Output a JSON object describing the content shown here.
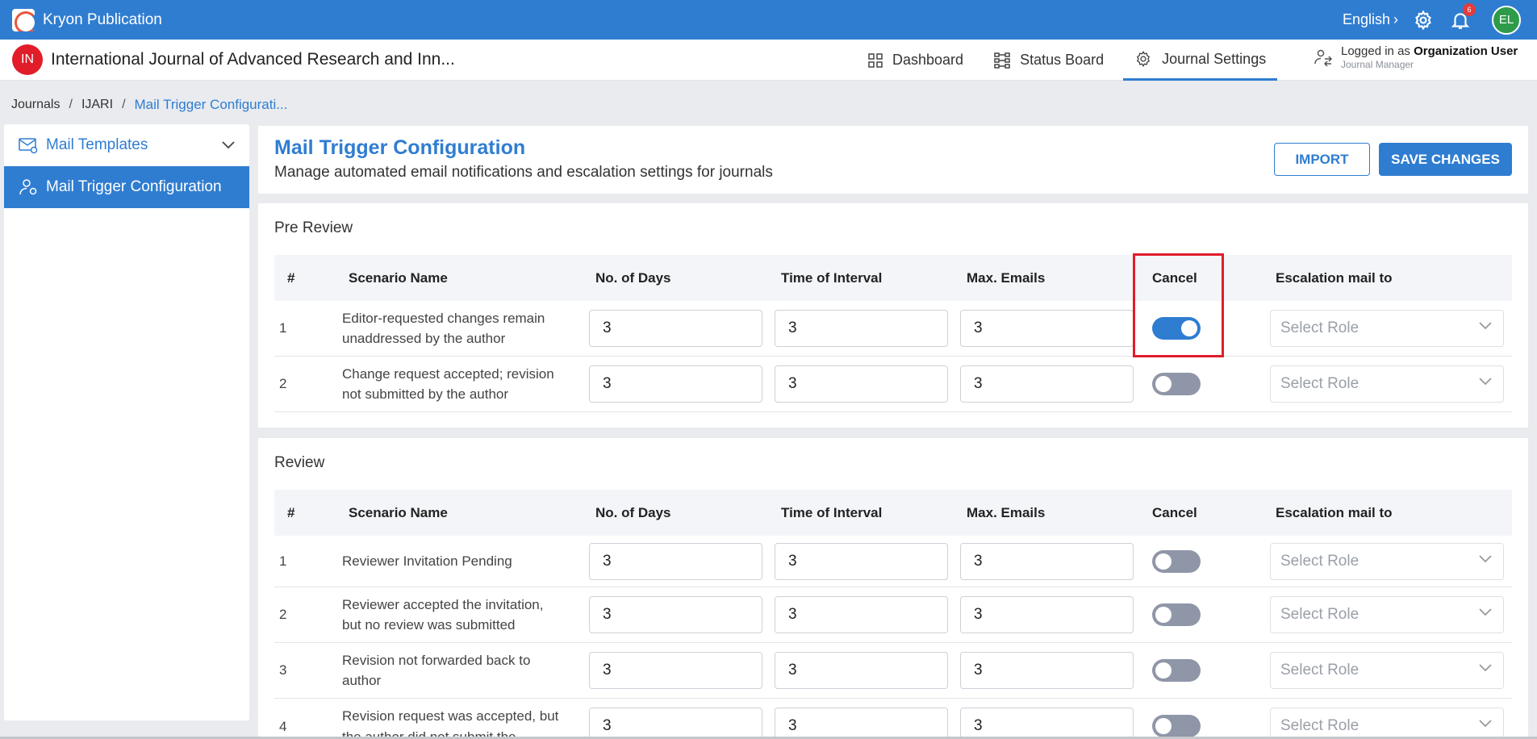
{
  "app": {
    "title": "Kryon Publication",
    "language": "English",
    "notification_count": "6",
    "avatar_initials": "EL"
  },
  "journal": {
    "badge": "IN",
    "title": "International Journal of Advanced Research and Inn...",
    "nav": {
      "dashboard": "Dashboard",
      "status_board": "Status Board",
      "journal_settings": "Journal Settings"
    },
    "login": {
      "prefix": "Logged in as",
      "user": "Organization User",
      "role": "Journal Manager"
    }
  },
  "breadcrumb": {
    "journals": "Journals",
    "short": "IJARI",
    "current": "Mail Trigger Configurati..."
  },
  "sidebar": {
    "mail_templates": "Mail Templates",
    "mail_trigger": "Mail Trigger Configuration"
  },
  "header": {
    "title": "Mail Trigger Configuration",
    "subtitle": "Manage automated email notifications and escalation settings for journals",
    "import_label": "IMPORT",
    "save_label": "SAVE CHANGES"
  },
  "columns": {
    "num": "#",
    "scenario": "Scenario Name",
    "days": "No. of Days",
    "interval": "Time of Interval",
    "max": "Max. Emails",
    "cancel": "Cancel",
    "escalation": "Escalation mail to"
  },
  "pre_review": {
    "title": "Pre Review",
    "rows": [
      {
        "num": "1",
        "scenario_l1": "Editor-requested changes remain",
        "scenario_l2": "unaddressed by the author",
        "days": "3",
        "interval": "3",
        "max": "3",
        "cancel": true,
        "role": "Select Role"
      },
      {
        "num": "2",
        "scenario_l1": "Change request accepted; revision",
        "scenario_l2": "not submitted by the author",
        "days": "3",
        "interval": "3",
        "max": "3",
        "cancel": false,
        "role": "Select Role"
      }
    ]
  },
  "review": {
    "title": "Review",
    "rows": [
      {
        "num": "1",
        "scenario_l1": "Reviewer Invitation Pending",
        "scenario_l2": "",
        "days": "3",
        "interval": "3",
        "max": "3",
        "cancel": false,
        "role": "Select Role"
      },
      {
        "num": "2",
        "scenario_l1": "Reviewer accepted the invitation,",
        "scenario_l2": "but no review was submitted",
        "days": "3",
        "interval": "3",
        "max": "3",
        "cancel": false,
        "role": "Select Role"
      },
      {
        "num": "3",
        "scenario_l1": "Revision not forwarded back to",
        "scenario_l2": "author",
        "days": "3",
        "interval": "3",
        "max": "3",
        "cancel": false,
        "role": "Select Role"
      },
      {
        "num": "4",
        "scenario_l1": "Revision request was accepted, but",
        "scenario_l2": "the author did not submit the",
        "days": "3",
        "interval": "3",
        "max": "3",
        "cancel": false,
        "role": "Select Role"
      }
    ]
  },
  "colors": {
    "primary": "#2f7dd1",
    "highlight": "#e11d2a",
    "toggle_off": "#8f96a8"
  }
}
